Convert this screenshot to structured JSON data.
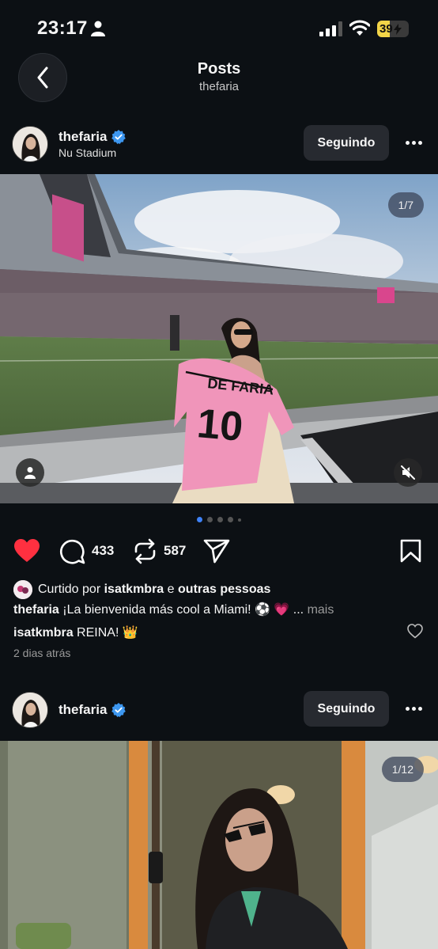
{
  "status_bar": {
    "time": "23:17",
    "battery": "39"
  },
  "nav": {
    "title": "Posts",
    "subtitle": "thefaria"
  },
  "post1": {
    "username": "thefaria",
    "location": "Nu Stadium",
    "follow_label": "Seguindo",
    "image_counter": "1/7",
    "jersey_name": "DE FARIA",
    "jersey_number": "10",
    "comments_count": "433",
    "reposts_count": "587",
    "liked_by_prefix": "Curtido por",
    "liked_by_user": "isatkmbra",
    "liked_by_conj": "e",
    "liked_by_others": "outras pessoas",
    "caption_user": "thefaria",
    "caption_text": "¡La bienvenida más cool a Miami! ⚽️ 💗 ...",
    "caption_more": "mais",
    "comment_user": "isatkmbra",
    "comment_text": "REINA! 👑",
    "time_ago": "2 dias atrás"
  },
  "post2": {
    "username": "thefaria",
    "follow_label": "Seguindo",
    "image_counter": "1/12"
  },
  "colors": {
    "like_red": "#ff3040",
    "active_dot": "#3e82f7",
    "verified_blue": "#3d97f0",
    "battery": "#f3d548"
  }
}
